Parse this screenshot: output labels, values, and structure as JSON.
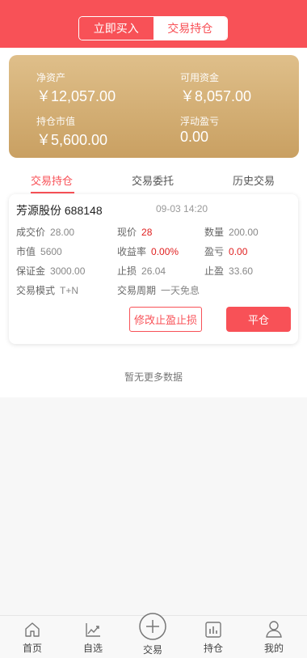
{
  "header": {
    "segments": [
      {
        "label": "立即买入",
        "active": false
      },
      {
        "label": "交易持仓",
        "active": true
      }
    ]
  },
  "assets": {
    "net_asset_label": "净资产",
    "net_asset_value": "￥12,057.00",
    "available_label": "可用资金",
    "available_value": "￥8,057.00",
    "market_value_label": "持仓市值",
    "market_value_value": "￥5,600.00",
    "float_pl_label": "浮动盈亏",
    "float_pl_value": "0.00"
  },
  "tabs": [
    {
      "label": "交易持仓",
      "active": true
    },
    {
      "label": "交易委托",
      "active": false
    },
    {
      "label": "历史交易",
      "active": false
    }
  ],
  "position": {
    "name": "芳源股份 688148",
    "time": "09-03 14:20",
    "deal_price_label": "成交价",
    "deal_price": "28.00",
    "current_price_label": "现价",
    "current_price": "28",
    "quantity_label": "数量",
    "quantity": "200.00",
    "market_value_label": "市值",
    "market_value": "5600",
    "return_rate_label": "收益率",
    "return_rate": "0.00%",
    "pl_label": "盈亏",
    "pl": "0.00",
    "margin_label": "保证金",
    "margin": "3000.00",
    "stop_loss_label": "止损",
    "stop_loss": "26.04",
    "take_profit_label": "止盈",
    "take_profit": "33.60",
    "trade_mode_label": "交易模式",
    "trade_mode": "T+N",
    "trade_period_label": "交易周期",
    "trade_period": "一天免息",
    "modify_button": "修改止盈止损",
    "close_button": "平仓"
  },
  "no_more_text": "暂无更多数据",
  "tabbar": [
    {
      "label": "首页",
      "icon": "home-icon"
    },
    {
      "label": "自选",
      "icon": "chart-trend-icon"
    },
    {
      "label": "交易",
      "icon": "plus-circle-icon"
    },
    {
      "label": "持仓",
      "icon": "bar-chart-icon"
    },
    {
      "label": "我的",
      "icon": "user-icon"
    }
  ],
  "colors": {
    "brand": "#f85157",
    "gold_top": "#dfbf8a",
    "gold_bottom": "#c9a062",
    "loss_red": "#e02020"
  }
}
